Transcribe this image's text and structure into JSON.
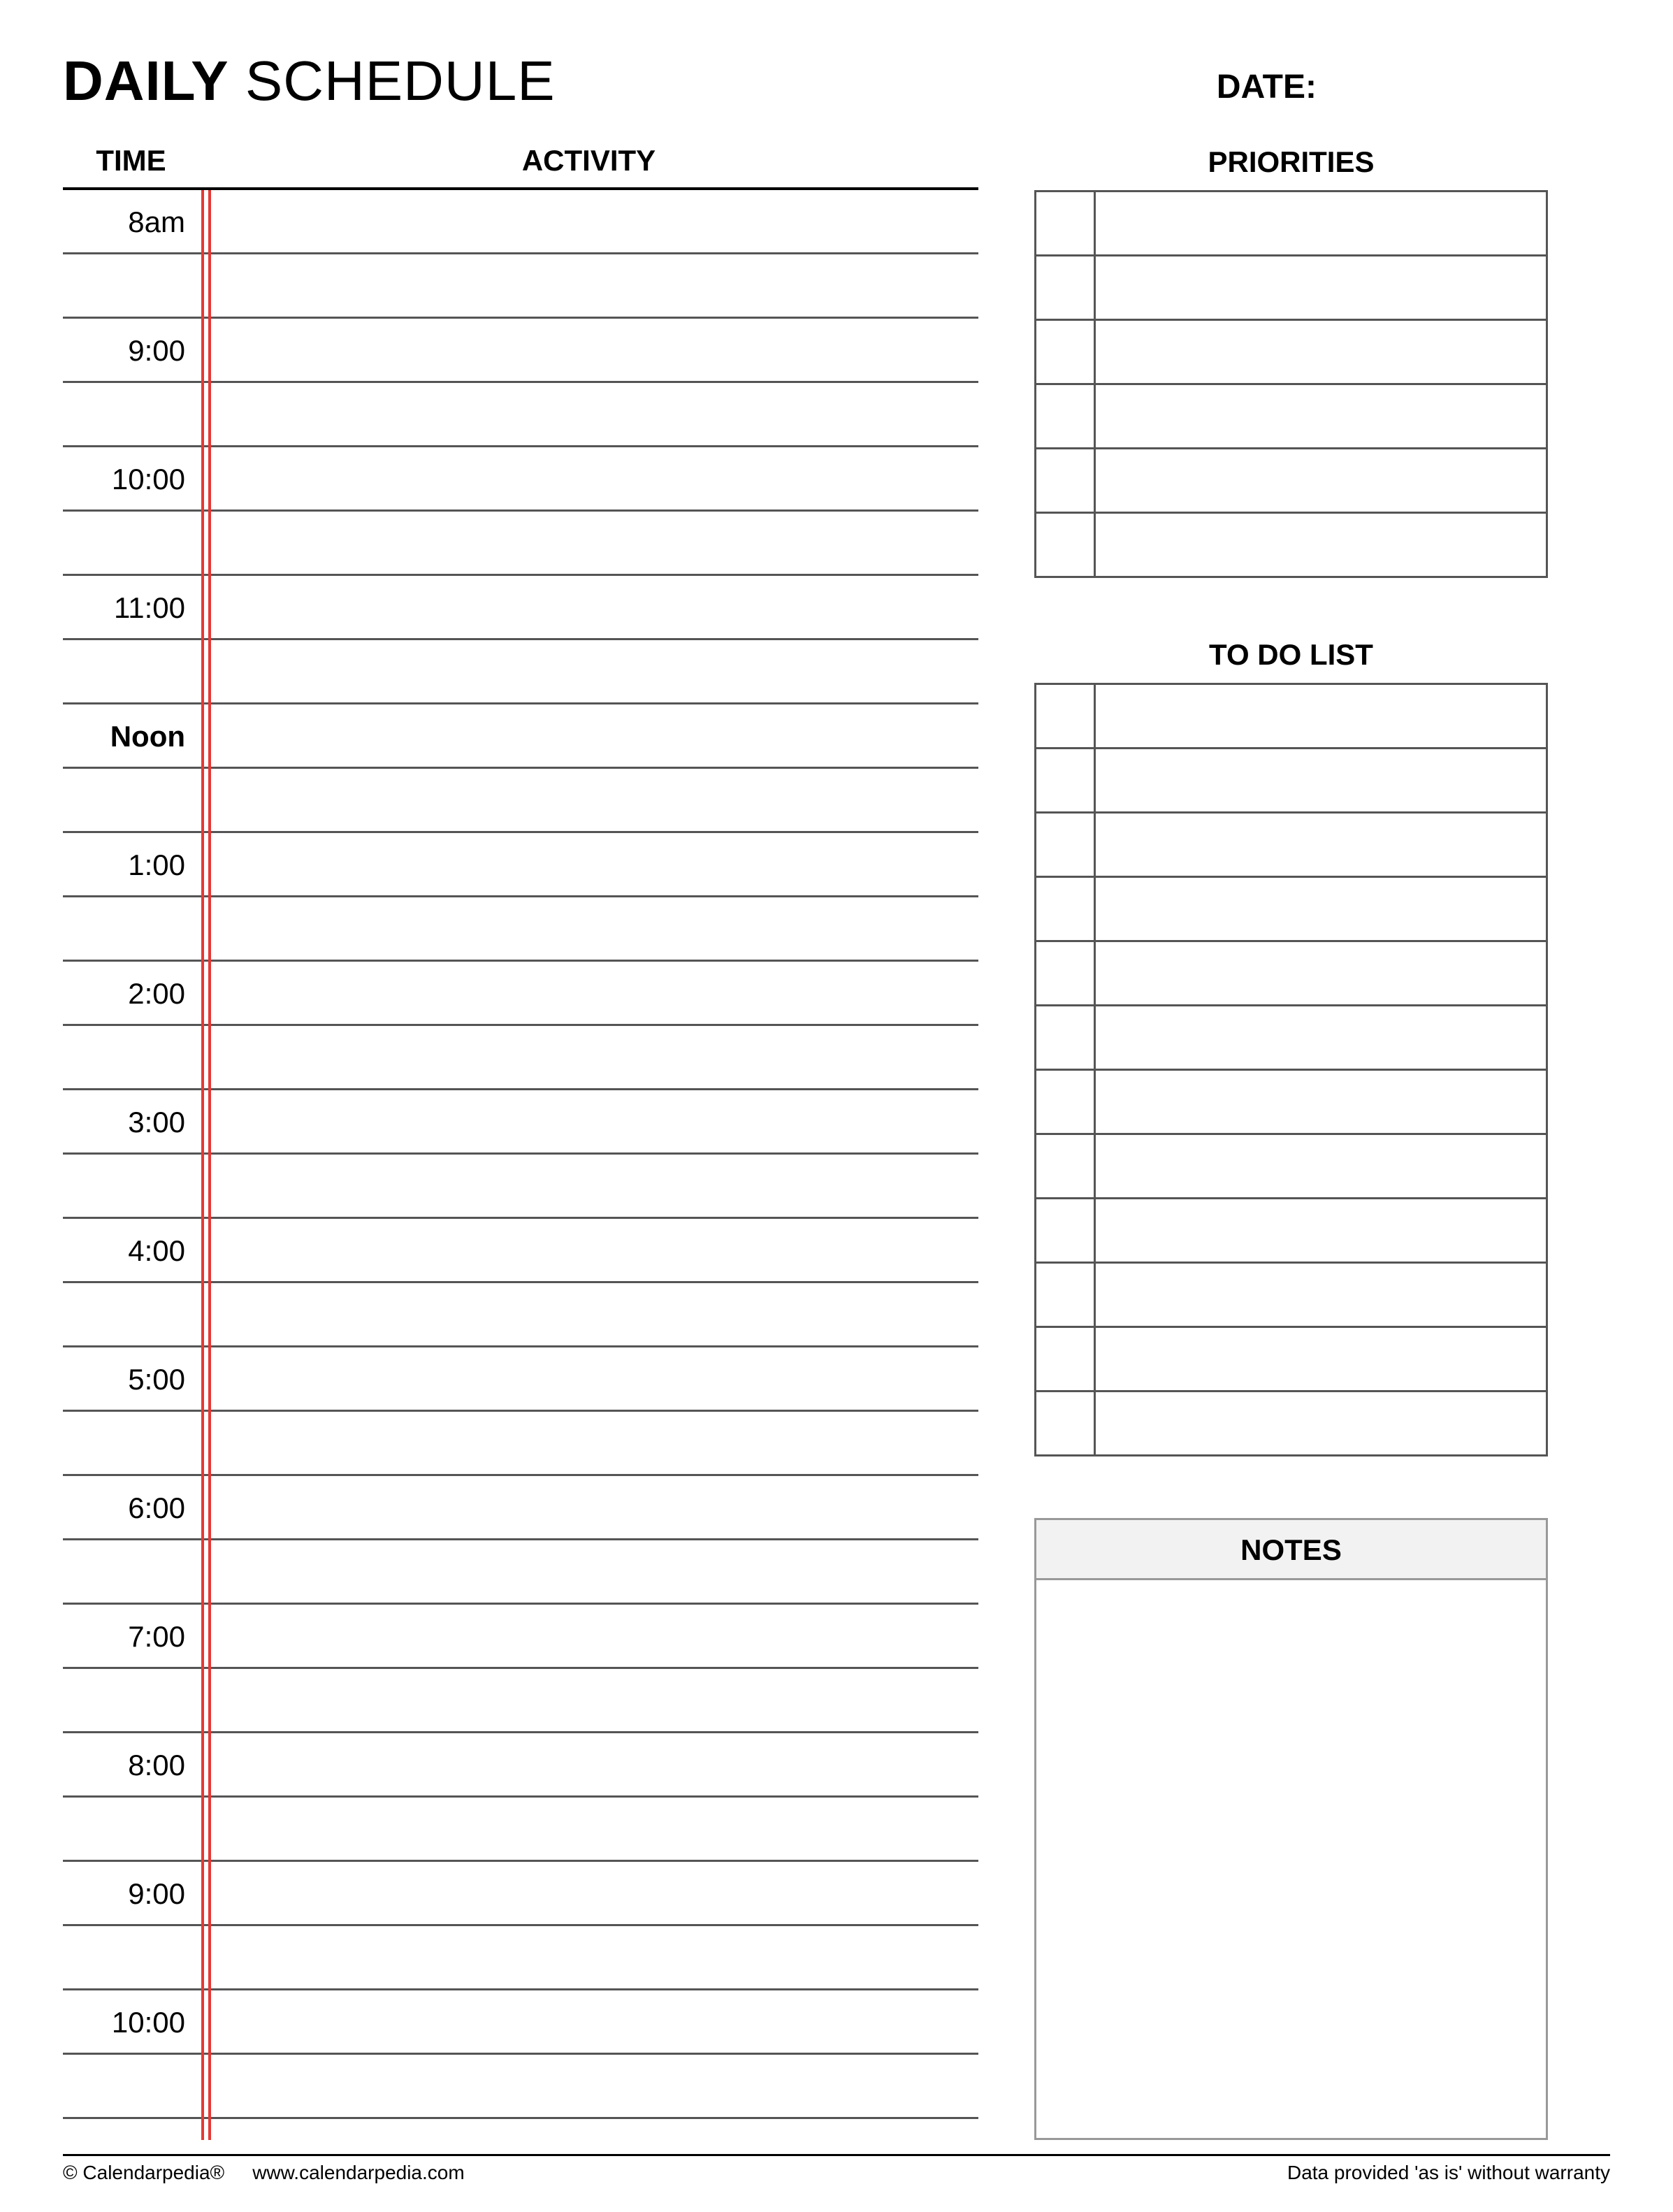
{
  "title_bold": "DAILY",
  "title_light": "SCHEDULE",
  "date_label": "DATE:",
  "schedule": {
    "time_header": "TIME",
    "activity_header": "ACTIVITY",
    "rows": [
      {
        "label": "8am",
        "kind": "first"
      },
      {
        "label": "",
        "kind": "half"
      },
      {
        "label": "9:00",
        "kind": "hour"
      },
      {
        "label": "",
        "kind": "half"
      },
      {
        "label": "10:00",
        "kind": "hour"
      },
      {
        "label": "",
        "kind": "half"
      },
      {
        "label": "11:00",
        "kind": "hour"
      },
      {
        "label": "",
        "kind": "half"
      },
      {
        "label": "Noon",
        "kind": "noon"
      },
      {
        "label": "",
        "kind": "half"
      },
      {
        "label": "1:00",
        "kind": "hour"
      },
      {
        "label": "",
        "kind": "half"
      },
      {
        "label": "2:00",
        "kind": "hour"
      },
      {
        "label": "",
        "kind": "half"
      },
      {
        "label": "3:00",
        "kind": "hour"
      },
      {
        "label": "",
        "kind": "half"
      },
      {
        "label": "4:00",
        "kind": "hour"
      },
      {
        "label": "",
        "kind": "half"
      },
      {
        "label": "5:00",
        "kind": "hour"
      },
      {
        "label": "",
        "kind": "half"
      },
      {
        "label": "6:00",
        "kind": "hour"
      },
      {
        "label": "",
        "kind": "half"
      },
      {
        "label": "7:00",
        "kind": "hour"
      },
      {
        "label": "",
        "kind": "half"
      },
      {
        "label": "8:00",
        "kind": "hour"
      },
      {
        "label": "",
        "kind": "half"
      },
      {
        "label": "9:00",
        "kind": "hour"
      },
      {
        "label": "",
        "kind": "half"
      },
      {
        "label": "10:00",
        "kind": "hour"
      },
      {
        "label": "",
        "kind": "half"
      }
    ]
  },
  "priorities": {
    "title": "PRIORITIES",
    "row_count": 6
  },
  "todo": {
    "title": "TO DO LIST",
    "row_count": 12
  },
  "notes": {
    "title": "NOTES"
  },
  "footer": {
    "copyright": "© Calendarpedia®",
    "url": "www.calendarpedia.com",
    "disclaimer": "Data provided 'as is' without warranty"
  }
}
